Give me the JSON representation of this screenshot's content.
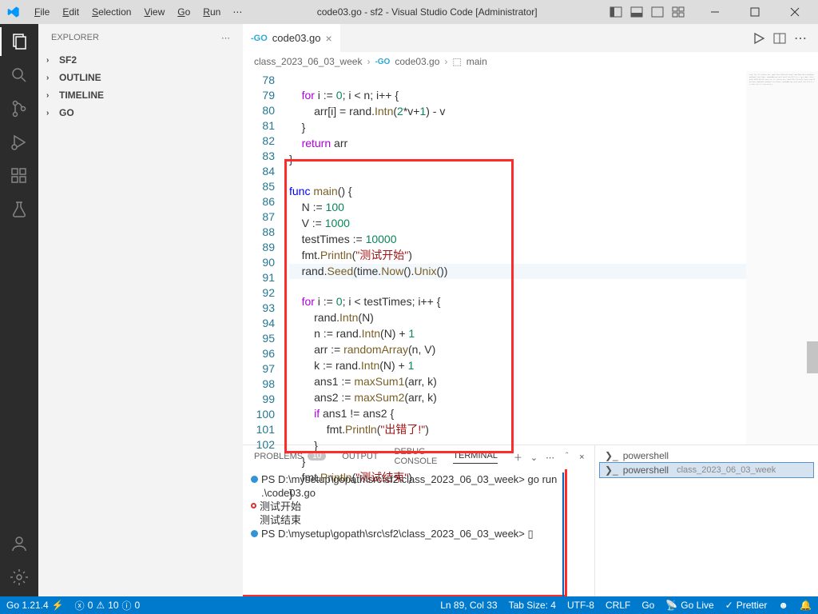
{
  "window": {
    "title": "code03.go - sf2 - Visual Studio Code [Administrator]"
  },
  "menu": {
    "file": "File",
    "edit": "Edit",
    "selection": "Selection",
    "view": "View",
    "go": "Go",
    "run": "Run"
  },
  "explorer": {
    "title": "EXPLORER",
    "sf2": "SF2",
    "outline": "OUTLINE",
    "timeline": "TIMELINE",
    "go": "GO"
  },
  "tab": {
    "name": "code03.go"
  },
  "breadcrumb": {
    "folder": "class_2023_06_03_week",
    "file": "code03.go",
    "func": "main"
  },
  "lines": {
    "78": "78",
    "79": "79",
    "80": "80",
    "81": "81",
    "82": "82",
    "83": "83",
    "84": "84",
    "85": "85",
    "86": "86",
    "87": "87",
    "88": "88",
    "89": "89",
    "90": "90",
    "91": "91",
    "92": "92",
    "93": "93",
    "94": "94",
    "95": "95",
    "96": "96",
    "97": "97",
    "98": "98",
    "99": "99",
    "100": "100",
    "101": "101",
    "102": "102"
  },
  "code": {
    "l78a": "for",
    "l78b": " i := ",
    "l78c": "0",
    "l78d": "; i < n; i++ {",
    "l79a": "arr[i] = rand.",
    "l79b": "Intn",
    "l79c": "(",
    "l79d": "2",
    "l79e": "*v+",
    "l79f": "1",
    "l79g": ") - v",
    "l80": "}",
    "l81a": "return",
    "l81b": " arr",
    "l82": "}",
    "l84a": "func",
    "l84b": " ",
    "l84c": "main",
    "l84d": "() {",
    "l85a": "N := ",
    "l85b": "100",
    "l86a": "V := ",
    "l86b": "1000",
    "l87a": "testTimes := ",
    "l87b": "10000",
    "l88a": "fmt.",
    "l88b": "Println",
    "l88c": "(",
    "l88d": "\"测试开始\"",
    "l88e": ")",
    "l89a": "rand.",
    "l89b": "Seed",
    "l89c": "(",
    "l89d": "time.",
    "l89e": "Now",
    "l89f": "().",
    "l89g": "Unix",
    "l89h": "())",
    "l90a": "for",
    "l90b": " i := ",
    "l90c": "0",
    "l90d": "; i < testTimes; i++ {",
    "l91a": "rand.",
    "l91b": "Intn",
    "l91c": "(N)",
    "l92a": "n := rand.",
    "l92b": "Intn",
    "l92c": "(N) + ",
    "l92d": "1",
    "l93a": "arr := ",
    "l93b": "randomArray",
    "l93c": "(n, V)",
    "l94a": "k := rand.",
    "l94b": "Intn",
    "l94c": "(N) + ",
    "l94d": "1",
    "l95a": "ans1 := ",
    "l95b": "maxSum1",
    "l95c": "(arr, k)",
    "l96a": "ans2 := ",
    "l96b": "maxSum2",
    "l96c": "(arr, k)",
    "l97a": "if",
    "l97b": " ans1 != ans2 {",
    "l98a": "fmt.",
    "l98b": "Println",
    "l98c": "(",
    "l98d": "\"出错了!\"",
    "l98e": ")",
    "l99": "}",
    "l100": "}",
    "l101a": "fmt.",
    "l101b": "Println",
    "l101c": "(",
    "l101d": "\"测试结束\"",
    "l101e": ")",
    "l102": "}"
  },
  "panel": {
    "problems": "PROBLEMS",
    "pcount": "10",
    "output": "OUTPUT",
    "debug": "DEBUG CONSOLE",
    "terminal": "TERMINAL"
  },
  "terminal": {
    "ps1": "PS D:\\mysetup\\gopath\\src\\sf2\\class_2023_06_03_week>",
    "cmd1": "go run .\\code03.go",
    "out1": "测试开始",
    "out2": "测试结束",
    "ps2": "PS D:\\mysetup\\gopath\\src\\sf2\\class_2023_06_03_week>",
    "cursor": "▯"
  },
  "termside": {
    "p1": "powershell",
    "p2": "powershell",
    "p2path": "class_2023_06_03_week"
  },
  "status": {
    "go": "Go 1.21.4",
    "err": "0",
    "warn": "10",
    "info": "0",
    "pos": "Ln 89, Col 33",
    "tab": "Tab Size: 4",
    "enc": "UTF-8",
    "eol": "CRLF",
    "lang": "Go",
    "live": "Go Live",
    "prettier": "Prettier"
  }
}
